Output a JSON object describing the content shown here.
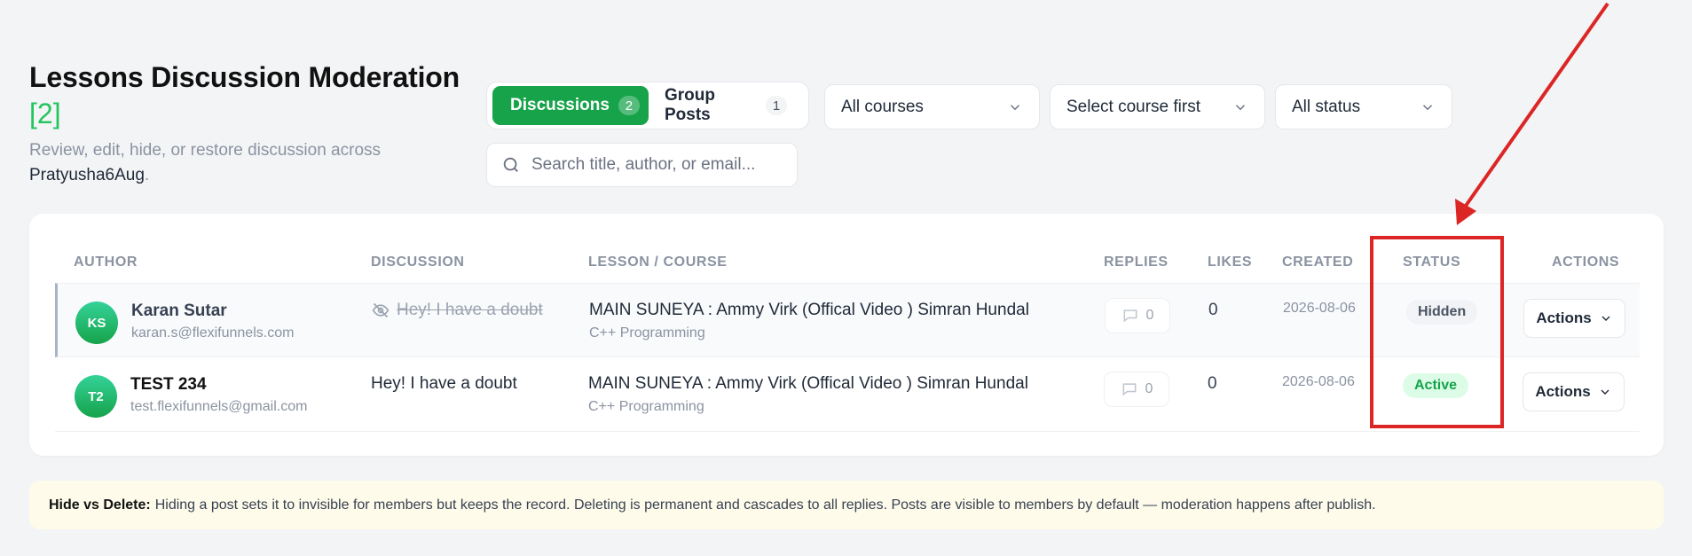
{
  "header": {
    "title": "Lessons Discussion Moderation",
    "count": "[2]",
    "subtitle": "Review, edit, hide, or restore discussion across",
    "course_name": "Pratyusha6Aug",
    "subtitle_end": "."
  },
  "tabs": [
    {
      "label": "Discussions",
      "count": "2"
    },
    {
      "label": "Group Posts",
      "count": "1"
    }
  ],
  "filters": {
    "courses": "All courses",
    "lesson": "Select course first",
    "status": "All status"
  },
  "search": {
    "placeholder": "Search title, author, or email..."
  },
  "table": {
    "headers": [
      "AUTHOR",
      "DISCUSSION",
      "LESSON / COURSE",
      "REPLIES",
      "LIKES",
      "CREATED",
      "STATUS",
      "ACTIONS"
    ],
    "rows": [
      {
        "initials": "KS",
        "name": "Karan Sutar",
        "email": "karan.s@flexifunnels.com",
        "discussion": "Hey! I have a doubt",
        "lesson": "MAIN SUNEYA : Ammy Virk (Offical Video ) Simran Hundal",
        "course": "C++ Programming",
        "replies": "0",
        "likes": "0",
        "created": "2026-08-06",
        "status": "Hidden",
        "action": "Actions"
      },
      {
        "initials": "T2",
        "name": "TEST 234",
        "email": "test.flexifunnels@gmail.com",
        "discussion": "Hey! I have a doubt",
        "lesson": "MAIN SUNEYA : Ammy Virk (Offical Video ) Simran Hundal",
        "course": "C++ Programming",
        "replies": "0",
        "likes": "0",
        "created": "2026-08-06",
        "status": "Active",
        "action": "Actions"
      }
    ]
  },
  "note": {
    "label": "Hide vs Delete:",
    "text": "Hiding a post sets it to invisible for members but keeps the record. Deleting is permanent and cascades to all replies. Posts are visible to members by default — moderation happens after publish."
  },
  "colors": {
    "accent": "#16a34a",
    "highlight": "#dc2626"
  },
  "icons": [
    "chevron-down-icon",
    "search-icon",
    "eye-off-icon",
    "comment-icon"
  ]
}
